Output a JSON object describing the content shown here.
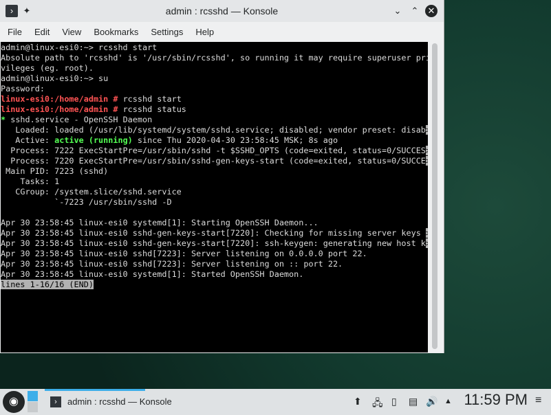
{
  "window": {
    "title": "admin : rcsshd — Konsole"
  },
  "menu": [
    "File",
    "Edit",
    "View",
    "Bookmarks",
    "Settings",
    "Help"
  ],
  "terminal": {
    "lines": [
      {
        "t": "admin@linux-esi0:~> rcsshd start"
      },
      {
        "t": "Absolute path to 'rcsshd' is '/usr/sbin/rcsshd', so running it may require superuser pri"
      },
      {
        "t": "vileges (eg. root)."
      },
      {
        "t": "admin@linux-esi0:~> su"
      },
      {
        "t": "Password:"
      },
      {
        "p": "linux-esi0:/home/admin #",
        "t": " rcsshd start"
      },
      {
        "p": "linux-esi0:/home/admin #",
        "t": " rcsshd status"
      },
      {
        "g": "*",
        "t": " sshd.service - OpenSSH Daemon"
      },
      {
        "t": "   Loaded: loaded (/usr/lib/systemd/system/sshd.service; disabled; vendor preset: disab",
        "r": ">"
      },
      {
        "t": "   Active: ",
        "g": "active (running)",
        "t2": " since Thu 2020-04-30 23:58:45 MSK; 8s ago"
      },
      {
        "t": "  Process: 7222 ExecStartPre=/usr/sbin/sshd -t $SSHD_OPTS (code=exited, status=0/SUCCES",
        "r": ">"
      },
      {
        "t": "  Process: 7220 ExecStartPre=/usr/sbin/sshd-gen-keys-start (code=exited, status=0/SUCCE",
        "r": ">"
      },
      {
        "t": " Main PID: 7223 (sshd)"
      },
      {
        "t": "    Tasks: 1"
      },
      {
        "t": "   CGroup: /system.slice/sshd.service"
      },
      {
        "t": "           `-7223 /usr/sbin/sshd -D"
      },
      {
        "t": ""
      },
      {
        "t": "Apr 30 23:58:45 linux-esi0 systemd[1]: Starting OpenSSH Daemon..."
      },
      {
        "t": "Apr 30 23:58:45 linux-esi0 sshd-gen-keys-start[7220]: Checking for missing server keys ",
        "r": ">"
      },
      {
        "t": "Apr 30 23:58:45 linux-esi0 sshd-gen-keys-start[7220]: ssh-keygen: generating new host k",
        "r": ">"
      },
      {
        "t": "Apr 30 23:58:45 linux-esi0 sshd[7223]: Server listening on 0.0.0.0 port 22."
      },
      {
        "t": "Apr 30 23:58:45 linux-esi0 sshd[7223]: Server listening on :: port 22."
      },
      {
        "t": "Apr 30 23:58:45 linux-esi0 systemd[1]: Started OpenSSH Daemon."
      },
      {
        "r": "lines 1-16/16 (END)"
      }
    ]
  },
  "taskbar": {
    "task_label": "admin : rcsshd — Konsole",
    "clock": "11:59 PM"
  }
}
